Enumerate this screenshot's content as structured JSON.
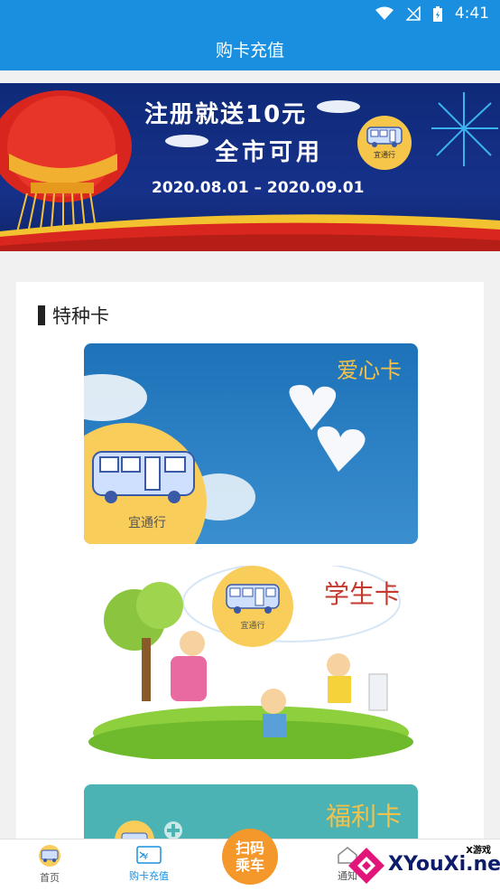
{
  "status_bar": {
    "time": "4:41"
  },
  "app_bar": {
    "title": "购卡充值"
  },
  "banner": {
    "headline": "注册就送10元",
    "subline": "全市可用",
    "dates": "2020.08.01 – 2020.09.01",
    "badge_text": "宜通行"
  },
  "section": {
    "title": "特种卡"
  },
  "cards": [
    {
      "title": "爱心卡",
      "badge_text": "宜通行"
    },
    {
      "title": "学生卡",
      "badge_text": "宜通行"
    },
    {
      "title": "福利卡"
    }
  ],
  "tabbar": {
    "home": "首页",
    "recharge": "购卡充值",
    "scan_line1": "扫码",
    "scan_line2": "乘车",
    "notice": "通知"
  },
  "watermark": {
    "small": "X游戏",
    "big": "XYouXi.net"
  },
  "colors": {
    "primary": "#1a8fe0",
    "accent": "#f4982c",
    "badge": "#f8cd5a"
  },
  "icons": [
    "wifi-icon",
    "no-signal-icon",
    "battery-icon",
    "bus-icon",
    "card-recharge-icon",
    "home-icon"
  ]
}
